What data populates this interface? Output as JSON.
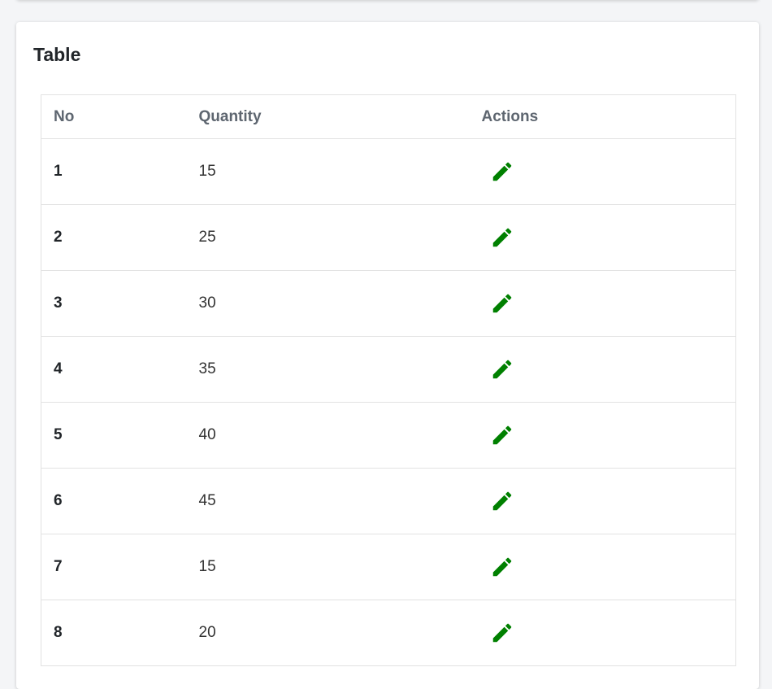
{
  "card": {
    "title": "Table"
  },
  "table": {
    "headers": {
      "no": "No",
      "quantity": "Quantity",
      "actions": "Actions"
    },
    "rows": [
      {
        "no": "1",
        "quantity": "15"
      },
      {
        "no": "2",
        "quantity": "25"
      },
      {
        "no": "3",
        "quantity": "30"
      },
      {
        "no": "4",
        "quantity": "35"
      },
      {
        "no": "5",
        "quantity": "40"
      },
      {
        "no": "6",
        "quantity": "45"
      },
      {
        "no": "7",
        "quantity": "15"
      },
      {
        "no": "8",
        "quantity": "20"
      }
    ],
    "action_icon": "pencil-icon"
  },
  "colors": {
    "accent": "#008000",
    "header_text": "#5e6670",
    "border": "#e2e2e2"
  }
}
